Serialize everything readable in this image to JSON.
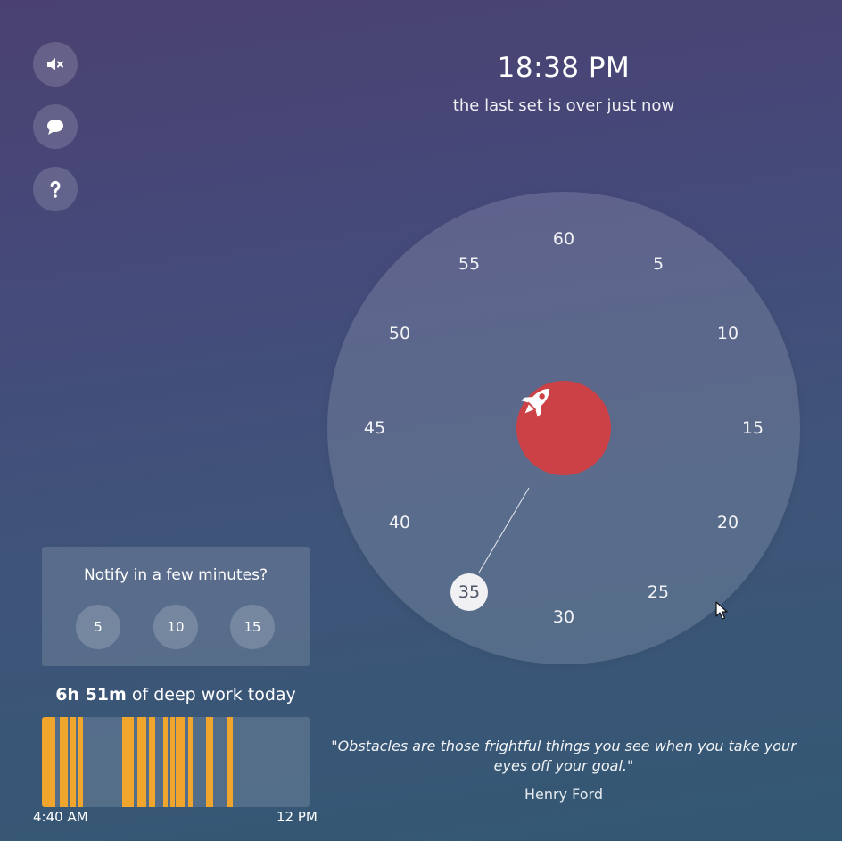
{
  "sidebar": {
    "buttons": [
      {
        "icon": "mute-icon"
      },
      {
        "icon": "chat-icon"
      },
      {
        "icon": "help-icon"
      }
    ]
  },
  "clock": {
    "time": "18:38 PM",
    "status": "the last set is over just now"
  },
  "dial": {
    "numbers": [
      "60",
      "5",
      "10",
      "15",
      "20",
      "25",
      "30",
      "35",
      "40",
      "45",
      "50",
      "55"
    ],
    "selected": "35",
    "center_icon": "rocket-icon",
    "accent_color": "#cc4145"
  },
  "notify": {
    "title": "Notify in a few minutes?",
    "options": [
      "5",
      "10",
      "15"
    ]
  },
  "deep_work": {
    "duration": "6h 51m",
    "suffix": " of deep work today",
    "timeline_start": "4:40 AM",
    "timeline_end": "12 PM",
    "bar_color": "#f0a52c"
  },
  "quote": {
    "text": "\"Obstacles are those frightful things you see when you take your eyes off your goal.\"",
    "author": "Henry Ford"
  }
}
